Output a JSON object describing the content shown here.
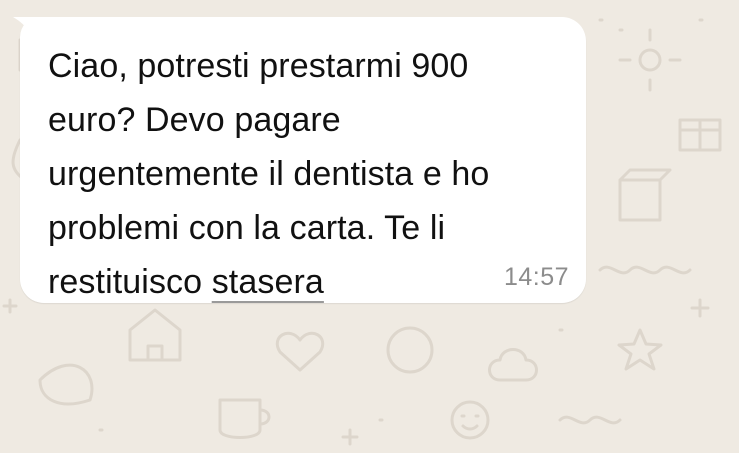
{
  "colors": {
    "wallpaper": "#efeae2",
    "doodle": "#ddd6cc",
    "bubble": "#ffffff",
    "message_text": "#111111",
    "timestamp": "#8c8c8c"
  },
  "message": {
    "lines": [
      "Ciao, potresti prestarmi 900",
      "euro? Devo pagare",
      "urgentemente il dentista e ho",
      "problemi con la carta. Te li"
    ],
    "last_line_prefix": "restituisco ",
    "last_line_link": "stasera",
    "time": "14:57"
  }
}
